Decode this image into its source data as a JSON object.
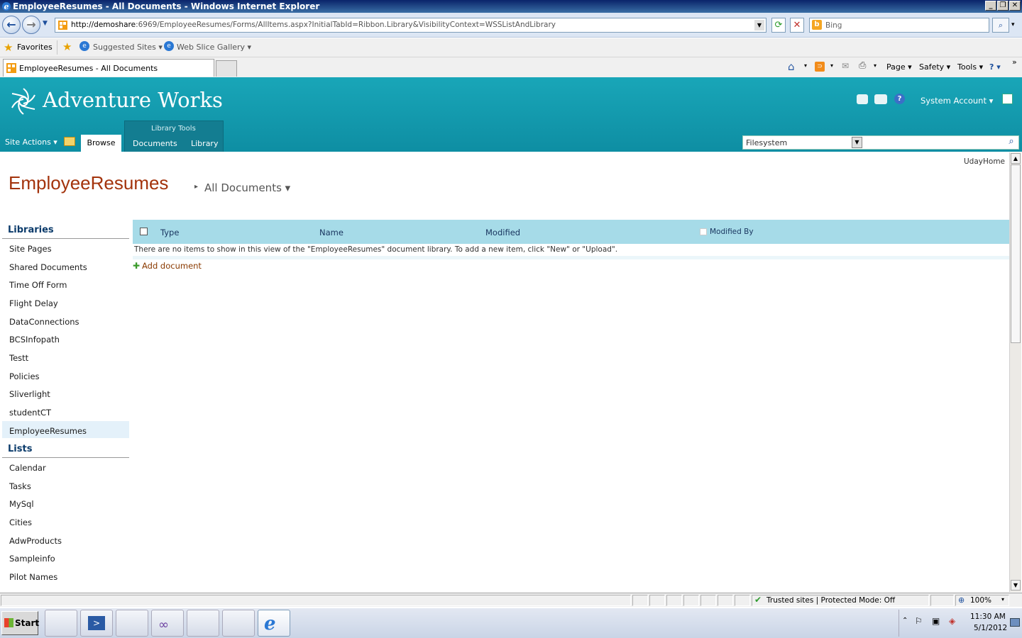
{
  "window": {
    "title": "EmployeeResumes - All Documents - Windows Internet Explorer",
    "min": "_",
    "max": "❐",
    "close": "✕"
  },
  "addressbar": {
    "url_host": "http://demoshare",
    "url_path": ":6969/EmployeeResumes/Forms/AllItems.aspx?InitialTabId=Ribbon.Library&VisibilityContext=WSSListAndLibrary",
    "search_placeholder": "Bing"
  },
  "favorites": {
    "label": "Favorites",
    "suggested": "Suggested Sites ▾",
    "webslice": "Web Slice Gallery ▾"
  },
  "tab": {
    "title": "EmployeeResumes - All Documents"
  },
  "commandbar": {
    "page": "Page ▾",
    "safety": "Safety ▾",
    "tools": "Tools ▾",
    "help": "? ▾"
  },
  "site": {
    "title": "Adventure Works",
    "user": "System Account ▾",
    "site_actions": "Site Actions ▾",
    "ribbon": {
      "browse": "Browse",
      "group_label": "Library Tools",
      "documents": "Documents",
      "library": "Library"
    },
    "search_scope": "Filesystem",
    "breadcrumb_link": "UdayHome"
  },
  "page": {
    "title": "EmployeeResumes",
    "view": "All Documents ▾",
    "separator": "▸"
  },
  "nav": {
    "libraries_header": "Libraries",
    "libraries": [
      "Site Pages",
      "Shared Documents",
      "Time Off Form",
      "Flight Delay",
      "DataConnections",
      "BCSInfopath",
      "Testt",
      "Policies",
      "Sliverlight",
      "studentCT",
      "EmployeeResumes"
    ],
    "lists_header": "Lists",
    "lists": [
      "Calendar",
      "Tasks",
      "MySql",
      "Cities",
      "AdwProducts",
      "Sampleinfo",
      "Pilot Names"
    ]
  },
  "list": {
    "columns": [
      "Type",
      "Name",
      "Modified",
      "Modified By"
    ],
    "empty_message": "There are no items to show in this view of the \"EmployeeResumes\" document library. To add a new item, click \"New\" or \"Upload\".",
    "add_document": "Add document"
  },
  "status": {
    "zone": "Trusted sites | Protected Mode: Off",
    "zoom": "100%"
  },
  "taskbar": {
    "start": "Start",
    "time": "11:30 AM",
    "date": "5/1/2012"
  },
  "colors": {
    "header_teal": "#19a6b8",
    "title_orange": "#a3330c",
    "list_header": "#a6dbe8"
  }
}
